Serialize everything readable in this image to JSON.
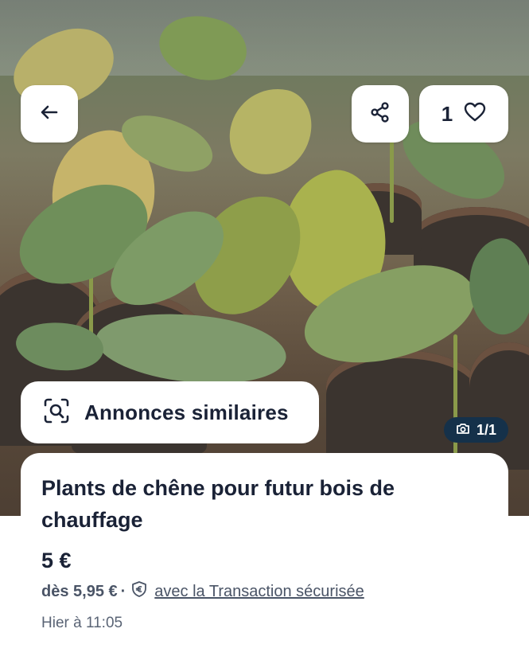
{
  "header": {
    "back_icon": "arrow-left-icon",
    "share_icon": "share-icon",
    "favorite_icon": "heart-icon",
    "favorite_count": "1"
  },
  "photo": {
    "counter": "1/1",
    "counter_icon": "camera-icon"
  },
  "similar": {
    "label": "Annonces similaires",
    "icon": "image-search-icon"
  },
  "listing": {
    "title": "Plants de chêne pour futur bois de chauffage",
    "price": "5 €",
    "from_price": "dès 5,95 €",
    "secure_label": "avec la Transaction sécurisée",
    "secure_icon": "euro-shield-icon",
    "date": "Hier à 11:05"
  },
  "colors": {
    "text_primary": "#1a2236",
    "badge_bg": "#15314a"
  }
}
